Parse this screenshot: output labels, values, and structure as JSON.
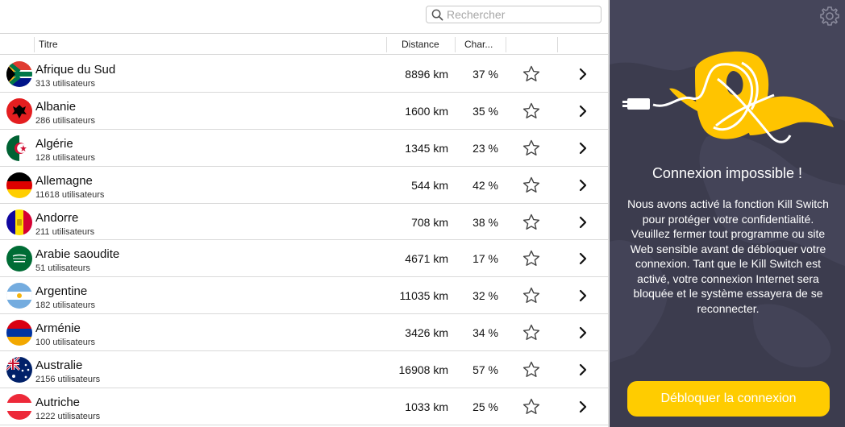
{
  "search": {
    "placeholder": "Rechercher"
  },
  "table": {
    "headers": {
      "title": "Titre",
      "distance": "Distance",
      "load": "Char..."
    },
    "rows": [
      {
        "name": "Afrique du Sud",
        "users": "313 utilisateurs",
        "distance": "8896 km",
        "load": "37 %",
        "flag": "south-africa"
      },
      {
        "name": "Albanie",
        "users": "286 utilisateurs",
        "distance": "1600 km",
        "load": "35 %",
        "flag": "albania"
      },
      {
        "name": "Algérie",
        "users": "128 utilisateurs",
        "distance": "1345 km",
        "load": "23 %",
        "flag": "algeria"
      },
      {
        "name": "Allemagne",
        "users": "11618 utilisateurs",
        "distance": "544 km",
        "load": "42 %",
        "flag": "germany"
      },
      {
        "name": "Andorre",
        "users": "211 utilisateurs",
        "distance": "708 km",
        "load": "38 %",
        "flag": "andorra"
      },
      {
        "name": "Arabie saoudite",
        "users": "51 utilisateurs",
        "distance": "4671 km",
        "load": "17 %",
        "flag": "saudi-arabia"
      },
      {
        "name": "Argentine",
        "users": "182 utilisateurs",
        "distance": "11035 km",
        "load": "32 %",
        "flag": "argentina"
      },
      {
        "name": "Arménie",
        "users": "100 utilisateurs",
        "distance": "3426 km",
        "load": "34 %",
        "flag": "armenia"
      },
      {
        "name": "Australie",
        "users": "2156 utilisateurs",
        "distance": "16908 km",
        "load": "57 %",
        "flag": "australia"
      },
      {
        "name": "Autriche",
        "users": "1222 utilisateurs",
        "distance": "1033 km",
        "load": "25 %",
        "flag": "austria"
      }
    ]
  },
  "panel": {
    "title": "Connexion impossible !",
    "message": "Nous avons activé la fonction Kill Switch pour protéger votre confidentialité. Veuillez fermer tout programme ou site Web sensible avant de débloquer votre connexion. Tant que le Kill Switch est activé, votre connexion Internet sera bloquée et le système essayera de se reconnecter.",
    "button_label": "Débloquer la connexion"
  },
  "colors": {
    "panel_bg": "#3c3c4e",
    "accent": "#ffcc00",
    "divider": "#d9d9d9"
  }
}
